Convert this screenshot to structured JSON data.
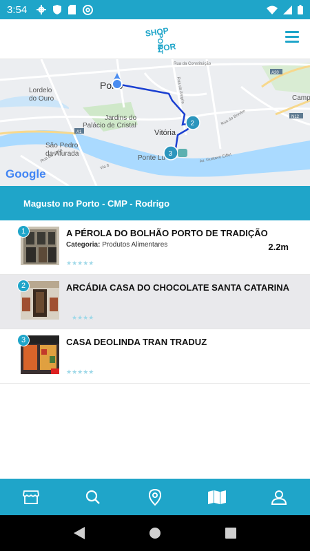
{
  "status_bar": {
    "time": "3:54",
    "left_icons": [
      "gear-icon",
      "shield-icon",
      "sd-card-icon",
      "at-sign-icon"
    ],
    "right_icons": [
      "wifi-icon",
      "signal-icon",
      "battery-icon"
    ]
  },
  "header": {
    "logo_text_top": "SHOP",
    "logo_text_bottom": "PORTO",
    "menu_icon": "hamburger-icon"
  },
  "map": {
    "labels": {
      "lordelo": "Lordelo",
      "do_ouro": "do Ouro",
      "porto": "Porto",
      "jardins1": "Jardins do",
      "jardins2": "Palácio de Cristal",
      "vitoria": "Vitória",
      "sao_pedro1": "São Pedro",
      "sao_pedro2": "da Afurada",
      "ponte": "Ponte Lu",
      "campanha": "Camp",
      "a20": "A20",
      "a1": "A1",
      "n12": "N12",
      "google": "Google",
      "rua_alegria": "Rua da Alegria",
      "rua_bonfim": "Rua do Bonfim",
      "rua_eiffel": "Av. Gustavo Eiffel",
      "rua_constituicao": "Rua da Constituição",
      "via8": "Via 8",
      "rua_prata": "Rua da Prata"
    },
    "markers": [
      "2",
      "3"
    ]
  },
  "route": {
    "title": "Magusto no Porto - CMP - Rodrigo"
  },
  "stops": [
    {
      "number": "1",
      "title": "A PÉROLA DO BOLHÃO PORTO DE TRADIÇÃO",
      "category_label": "Categoria:",
      "category_value": "Produtos Alimentares",
      "distance": "2.2m",
      "stars": "★★★★★"
    },
    {
      "number": "2",
      "title": "ARCÁDIA CASA DO CHOCOLATE SANTA CATARINA",
      "stars": "★★★★"
    },
    {
      "number": "3",
      "title": "CASA DEOLINDA TRAN TRADUZ",
      "stars": "★★★★★"
    }
  ],
  "bottom_nav": [
    "store-icon",
    "search-icon",
    "location-pin-icon",
    "map-icon",
    "user-icon"
  ],
  "system_nav": [
    "back-icon",
    "home-icon",
    "recents-icon"
  ],
  "colors": {
    "primary": "#1fa5c9",
    "route_line": "#1a3fd1",
    "water": "#aadaff"
  }
}
